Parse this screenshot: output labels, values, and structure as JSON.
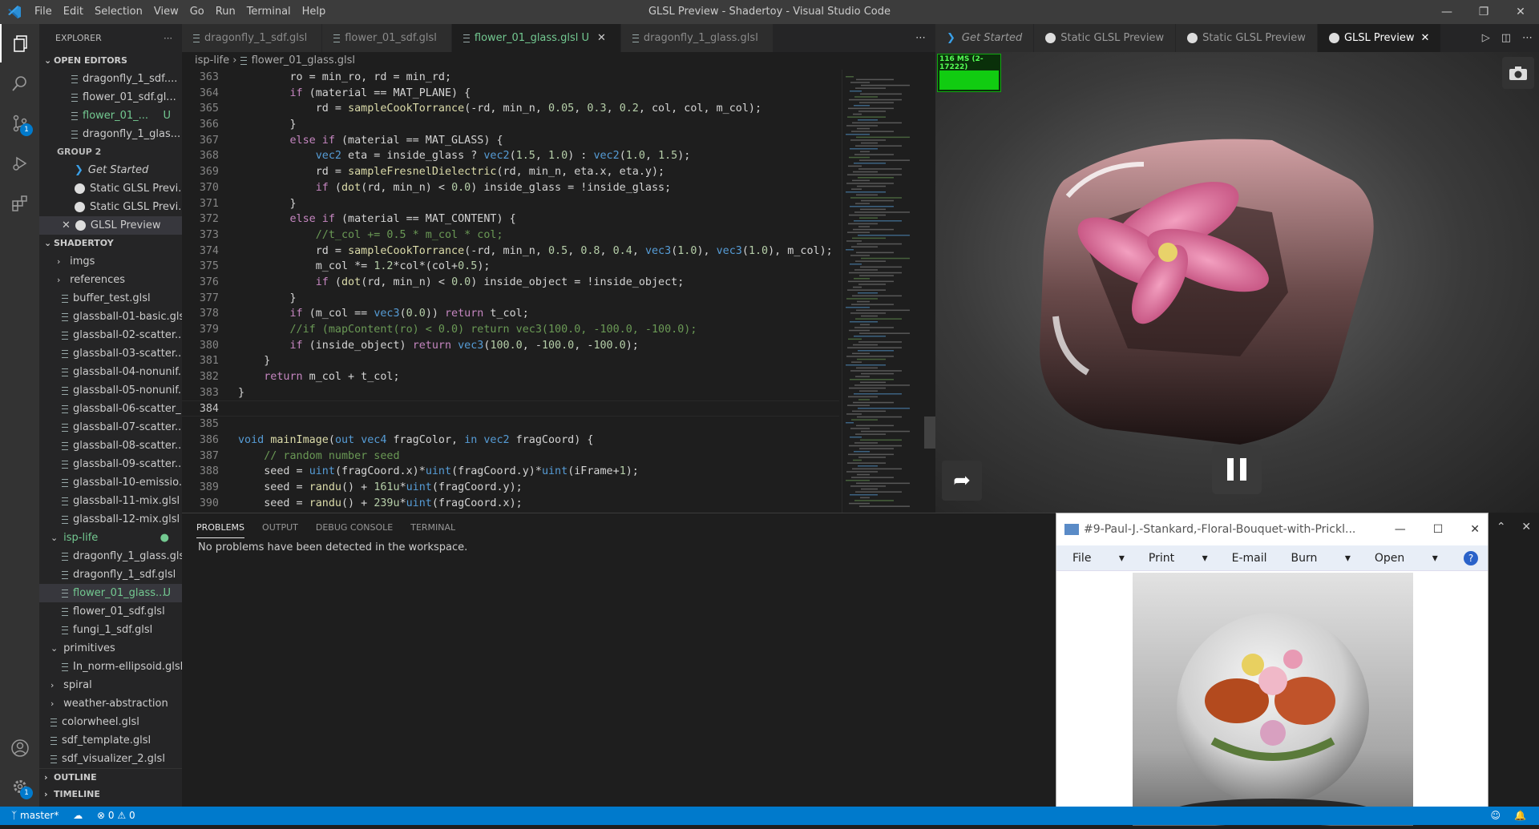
{
  "window": {
    "title": "GLSL Preview - Shadertoy - Visual Studio Code",
    "menu": [
      "File",
      "Edit",
      "Selection",
      "View",
      "Go",
      "Run",
      "Terminal",
      "Help"
    ]
  },
  "sidebar": {
    "title": "EXPLORER",
    "open_editors": {
      "label": "OPEN EDITORS",
      "items": [
        "dragonfly_1_sdf....",
        "flower_01_sdf.gl...",
        "flower_01_...",
        "dragonfly_1_glas..."
      ],
      "modified_marker": "U"
    },
    "group2": {
      "label": "GROUP 2",
      "items": [
        "Get Started",
        "Static GLSL Previ...",
        "Static GLSL Previ...",
        "GLSL Preview"
      ]
    },
    "shadertoy": {
      "label": "SHADERTOY",
      "folders": [
        "imgs",
        "references"
      ],
      "files": [
        "buffer_test.glsl",
        "glassball-01-basic.glsl",
        "glassball-02-scatter....",
        "glassball-03-scatter....",
        "glassball-04-nonunif...",
        "glassball-05-nonunif...",
        "glassball-06-scatter_...",
        "glassball-07-scatter....",
        "glassball-08-scatter....",
        "glassball-09-scatter....",
        "glassball-10-emissio...",
        "glassball-11-mix.glsl",
        "glassball-12-mix.glsl"
      ],
      "isp_life": {
        "label": "isp-life",
        "files": [
          "dragonfly_1_glass.glsl",
          "dragonfly_1_sdf.glsl",
          "flower_01_glass...",
          "flower_01_sdf.glsl",
          "fungi_1_sdf.glsl"
        ]
      },
      "primitives": {
        "label": "primitives",
        "files": [
          "In_norm-ellipsoid.glsl"
        ]
      },
      "spiral": "spiral",
      "weather": "weather-abstraction",
      "tail_files": [
        "colorwheel.glsl",
        "sdf_template.glsl",
        "sdf_visualizer_2.glsl"
      ]
    },
    "outline": "OUTLINE",
    "timeline": "TIMELINE"
  },
  "editor": {
    "tabs": [
      "dragonfly_1_sdf.glsl",
      "flower_01_sdf.glsl",
      "flower_01_glass.glsl U",
      "dragonfly_1_glass.glsl"
    ],
    "breadcrumb": [
      "isp-life",
      "flower_01_glass.glsl"
    ],
    "lines": [
      {
        "n": "363",
        "h": "        ro = min_ro, rd = min_rd;"
      },
      {
        "n": "364",
        "h": "        <span class='kw'>if</span> (material == MAT_PLANE) {"
      },
      {
        "n": "365",
        "h": "            rd = <span class='fn'>sampleCookTorrance</span>(-rd, min_n, <span class='nm'>0.05</span>, <span class='nm'>0.3</span>, <span class='nm'>0.2</span>, col, col, m_col);"
      },
      {
        "n": "366",
        "h": "        }"
      },
      {
        "n": "367",
        "h": "        <span class='kw'>else if</span> (material == MAT_GLASS) {"
      },
      {
        "n": "368",
        "h": "            <span class='ty'>vec2</span> eta = inside_glass ? <span class='ty'>vec2</span>(<span class='nm'>1.5</span>, <span class='nm'>1.0</span>) : <span class='ty'>vec2</span>(<span class='nm'>1.0</span>, <span class='nm'>1.5</span>);"
      },
      {
        "n": "369",
        "h": "            rd = <span class='fn'>sampleFresnelDielectric</span>(rd, min_n, eta.x, eta.y);"
      },
      {
        "n": "370",
        "h": "            <span class='kw'>if</span> (<span class='fn'>dot</span>(rd, min_n) &lt; <span class='nm'>0.0</span>) inside_glass = !inside_glass;"
      },
      {
        "n": "371",
        "h": "        }"
      },
      {
        "n": "372",
        "h": "        <span class='kw'>else if</span> (material == MAT_CONTENT) {"
      },
      {
        "n": "373",
        "h": "            <span class='cm'>//t_col += 0.5 * m_col * col;</span>"
      },
      {
        "n": "374",
        "h": "            rd = <span class='fn'>sampleCookTorrance</span>(-rd, min_n, <span class='nm'>0.5</span>, <span class='nm'>0.8</span>, <span class='nm'>0.4</span>, <span class='ty'>vec3</span>(<span class='nm'>1.0</span>), <span class='ty'>vec3</span>(<span class='nm'>1.0</span>), m_col);"
      },
      {
        "n": "375",
        "h": "            m_col *= <span class='nm'>1.2</span>*col*(col+<span class='nm'>0.5</span>);"
      },
      {
        "n": "376",
        "h": "            <span class='kw'>if</span> (<span class='fn'>dot</span>(rd, min_n) &lt; <span class='nm'>0.0</span>) inside_object = !inside_object;"
      },
      {
        "n": "377",
        "h": "        }"
      },
      {
        "n": "378",
        "h": "        <span class='kw'>if</span> (m_col == <span class='ty'>vec3</span>(<span class='nm'>0.0</span>)) <span class='kw'>return</span> t_col;"
      },
      {
        "n": "379",
        "h": "        <span class='cm'>//if (mapContent(ro) &lt; 0.0) return vec3(100.0, -100.0, -100.0);</span>"
      },
      {
        "n": "380",
        "h": "        <span class='kw'>if</span> (inside_object) <span class='kw'>return</span> <span class='ty'>vec3</span>(<span class='nm'>100.0</span>, -<span class='nm'>100.0</span>, -<span class='nm'>100.0</span>);"
      },
      {
        "n": "381",
        "h": "    }"
      },
      {
        "n": "382",
        "h": "    <span class='kw'>return</span> m_col + t_col;"
      },
      {
        "n": "383",
        "h": "}"
      },
      {
        "n": "384",
        "h": ""
      },
      {
        "n": "385",
        "h": ""
      },
      {
        "n": "386",
        "h": "<span class='ty'>void</span> <span class='fn'>mainImage</span>(<span class='ty'>out</span> <span class='ty'>vec4</span> fragColor, <span class='ty'>in</span> <span class='ty'>vec2</span> fragCoord) {"
      },
      {
        "n": "387",
        "h": "    <span class='cm'>// random number seed</span>"
      },
      {
        "n": "388",
        "h": "    seed = <span class='ty'>uint</span>(fragCoord.x)*<span class='ty'>uint</span>(fragCoord.y)*<span class='ty'>uint</span>(iFrame+<span class='nm'>1</span>);"
      },
      {
        "n": "389",
        "h": "    seed = <span class='fn'>randu</span>() + <span class='nm'>161u</span>*<span class='ty'>uint</span>(fragCoord.y);"
      },
      {
        "n": "390",
        "h": "    seed = <span class='fn'>randu</span>() + <span class='nm'>239u</span>*<span class='ty'>uint</span>(fragCoord.x);"
      }
    ],
    "current_line": "384"
  },
  "panel": {
    "tabs": [
      "PROBLEMS",
      "OUTPUT",
      "DEBUG CONSOLE",
      "TERMINAL"
    ],
    "message": "No problems have been detected in the workspace."
  },
  "preview": {
    "tabs": [
      "Get Started",
      "Static GLSL Preview",
      "Static GLSL Preview",
      "GLSL Preview"
    ],
    "fps": "116 MS (2-17222)"
  },
  "viewer": {
    "title": "#9-Paul-J.-Stankard,-Floral-Bouquet-with-Prickl...",
    "menu": [
      "File",
      "Print",
      "E-mail",
      "Burn",
      "Open"
    ]
  },
  "status": {
    "branch": "master*",
    "errors": "0",
    "warnings": "0"
  }
}
